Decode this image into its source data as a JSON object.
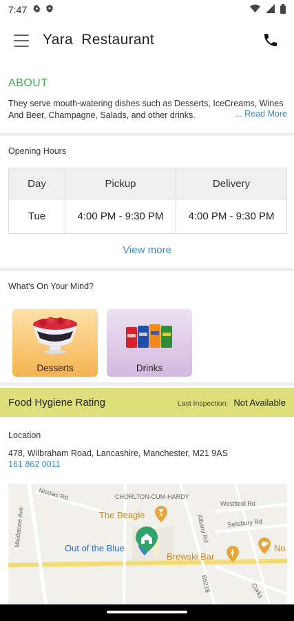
{
  "status_bar": {
    "time": "7:47"
  },
  "app_bar": {
    "title": "Yara  Restaurant"
  },
  "about": {
    "heading": "ABOUT",
    "text": "They serve mouth-watering dishes such as Desserts, IceCreams, Wines And Beer, Champagne, Salads, and other drinks.",
    "read_more": "... Read More"
  },
  "opening_hours": {
    "label": "Opening Hours",
    "headers": [
      "Day",
      "Pickup",
      "Delivery"
    ],
    "rows": [
      {
        "day": "Tue",
        "pickup": "4:00 PM - 9:30 PM",
        "delivery": "4:00 PM - 9:30 PM"
      }
    ],
    "view_more": "View more"
  },
  "categories": {
    "label": "What's On Your Mind?",
    "items": [
      {
        "label": "Desserts"
      },
      {
        "label": "Drinks"
      }
    ]
  },
  "hygiene": {
    "title": "Food Hygiene Rating",
    "last_inspection_label": "Last Inspection:",
    "last_inspection_value": "Not Available"
  },
  "location": {
    "label": "Location",
    "address": "478, Wilbraham Road, Lancashire, Manchester, M21 9AS",
    "phone": "161 862 0011"
  },
  "map": {
    "area_label": "CHORLTON-CUM-HARDY",
    "streets": [
      "Nicolas Rd",
      "Westfield Rd",
      "Salisbury Rd",
      "Maidstone Ave",
      "Albany Rd",
      "B5218",
      "Corks"
    ],
    "pois": [
      {
        "name": "The Beagle",
        "color": "#e8a33a"
      },
      {
        "name": "Out of the Blue",
        "color": "#3a7fd5"
      },
      {
        "name": "Brewski Bar",
        "color": "#e8a33a"
      },
      {
        "name": "No",
        "color": "#e8a33a"
      }
    ],
    "restaurant_marker_color": "#2ea36b"
  }
}
